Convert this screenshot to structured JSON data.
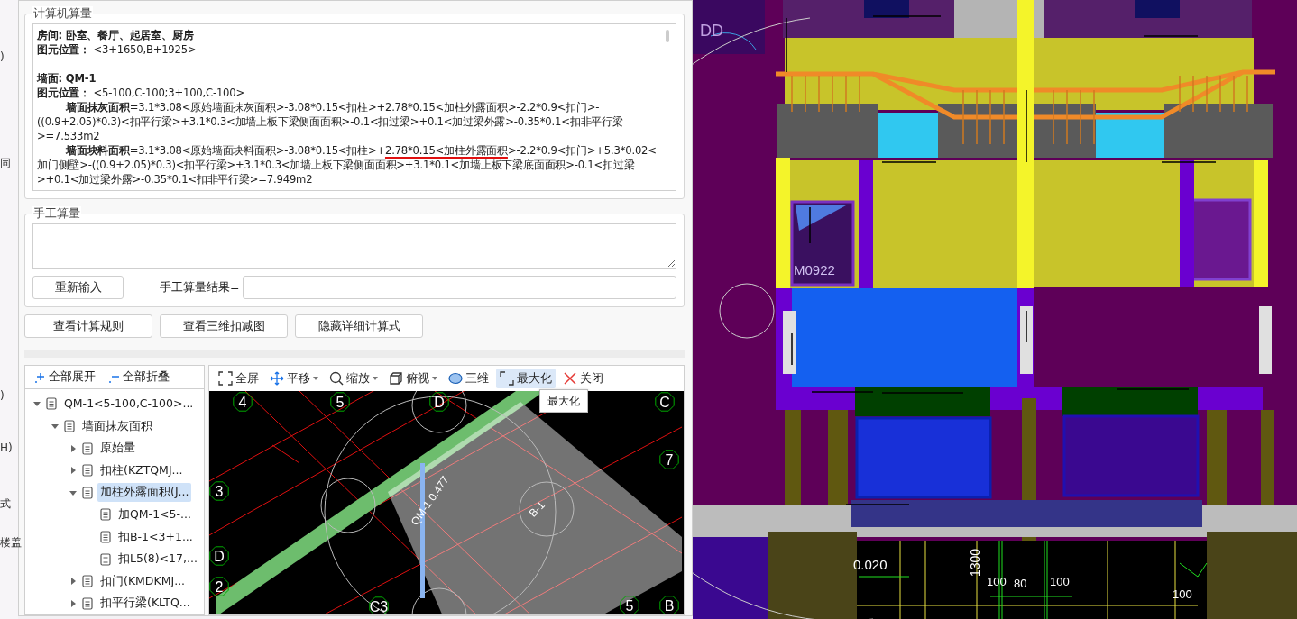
{
  "background_fragments": [
    {
      "text": ")"
    },
    {
      "text": "同"
    },
    {
      "text": ")"
    },
    {
      "text": "H)"
    },
    {
      "text": "式"
    },
    {
      "text": "楼盖"
    }
  ],
  "computer_calc": {
    "title": "计算机算量",
    "lines": [
      {
        "kind": "heading",
        "text": "房间: 卧室、餐厅、起居室、厨房"
      },
      {
        "kind": "field",
        "text": "**图元位置：** <3+1650,B+1925>"
      },
      {
        "kind": "spacer"
      },
      {
        "kind": "heading",
        "text": "墙面: QM-1"
      },
      {
        "kind": "field",
        "text": "**图元位置：** <5-100,C-100;3+100,C-100>"
      },
      {
        "kind": "formula",
        "label": "墙面抹灰面积",
        "parts": [
          {
            "text": "=3.1*3.08<原始墙面抹灰面积>-3.08*0.15<扣柱>+2.78*0.15<加柱外露面积>-2.2*0.9<扣门>-((0.9+2.05)*0.3)<扣平行梁>+3.1*0.3<加墙上板下梁侧面面积>-0.1<扣过梁>+0.1<加过梁外露>-0.35*0.1<扣非平行梁>=7.533m2",
            "underlined": false
          }
        ]
      },
      {
        "kind": "formula",
        "label": "墙面块料面积",
        "parts": [
          {
            "text": "=3.1*3.08<原始墙面块料面积>-3.08*0.15<扣柱>+",
            "underlined": false
          },
          {
            "text": "2.78*0.15<加柱外露面积",
            "underlined": true
          },
          {
            "text": ">-2.2*0.9<扣门>+5.3*0.02<加门侧壁>-((0.9+2.05)*0.3)<扣平行梁>+3.1*0.3<加墙上板下梁侧面面积>+3.1*0.1<加墙上板下梁底面面积>-0.1<扣过梁>+0.1<加过梁外露>-0.35*0.1<扣非平行梁>=7.949m2",
            "underlined": false
          }
        ]
      }
    ]
  },
  "manual_calc": {
    "title": "手工算量",
    "reenter_button": "重新输入",
    "result_label": "手工算量结果="
  },
  "action_buttons": [
    "查看计算规则",
    "查看三维扣减图",
    "隐藏详细计算式"
  ],
  "tree_toolbar": [
    "全部展开",
    "全部折叠"
  ],
  "tree": [
    {
      "label": "QM-1<5-100,C-100>...",
      "expanded": true,
      "selected": false,
      "children": [
        {
          "label": "墙面抹灰面积",
          "expanded": true,
          "selected": false,
          "children": [
            {
              "label": "原始量",
              "expanded": false,
              "selected": false
            },
            {
              "label": "扣柱(KZTQMJ...",
              "expanded": false,
              "selected": false
            },
            {
              "label": "加柱外露面积(J...",
              "expanded": true,
              "selected": true,
              "children": [
                {
                  "label": "加QM-1<5-...",
                  "selected": false
                },
                {
                  "label": "扣B-1<3+1...",
                  "selected": false
                },
                {
                  "label": "扣L5(8)<17,...",
                  "selected": false
                }
              ]
            },
            {
              "label": "扣门(KMDKMJ...",
              "expanded": false,
              "selected": false
            },
            {
              "label": "扣平行梁(KLTQ...",
              "expanded": false,
              "selected": false
            }
          ]
        }
      ]
    }
  ],
  "viewer_toolbar": [
    {
      "kind": "fullscreen",
      "label": "全屏",
      "dropdown": false,
      "selected": false
    },
    {
      "kind": "pan",
      "label": "平移",
      "dropdown": true,
      "selected": false
    },
    {
      "kind": "zoom",
      "label": "缩放",
      "dropdown": true,
      "selected": false
    },
    {
      "kind": "view",
      "label": "俯视",
      "dropdown": true,
      "selected": false
    },
    {
      "kind": "threed",
      "label": "三维",
      "dropdown": false,
      "selected": false
    },
    {
      "kind": "maximize",
      "label": "最大化",
      "dropdown": false,
      "selected": true
    },
    {
      "kind": "close",
      "label": "关闭",
      "dropdown": false,
      "selected": false
    }
  ],
  "tooltip": "最大化",
  "plan_view": {
    "axis_labels": [
      "4",
      "5",
      "D",
      "C",
      "7",
      "3",
      "D",
      "2",
      "C3",
      "5",
      "B"
    ],
    "element_labels": [
      "QM-1 0.477",
      "B-1"
    ]
  },
  "model_view": {
    "labels": [
      {
        "kind": "room",
        "text": "DD"
      },
      {
        "kind": "door",
        "text": "M0922"
      },
      {
        "kind": "elevation",
        "text": "0.020"
      },
      {
        "kind": "dimension-vertical",
        "text": "1300"
      },
      {
        "kind": "dimension",
        "text": "100"
      },
      {
        "kind": "dimension",
        "text": "80"
      },
      {
        "kind": "dimension",
        "text": "100"
      },
      {
        "kind": "dimension",
        "text": "100"
      }
    ]
  }
}
